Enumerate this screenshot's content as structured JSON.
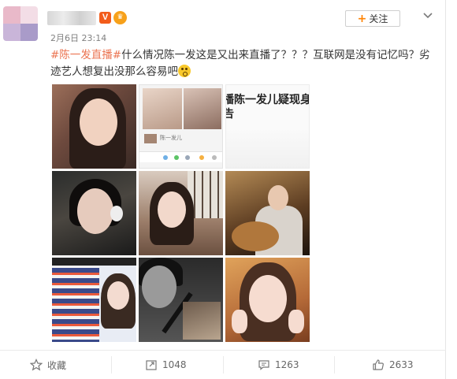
{
  "post": {
    "time": "2月6日 23:14",
    "follow_label": "关注",
    "hashtag": "#陈一发直播#",
    "text": "什么情况陈一发这是又出来直播了？？？互联网是没有记忆吗？劣迹艺人想复出没那么容易吧"
  },
  "images": {
    "thumb2_caption": "陈一发儿",
    "thumb3_headline_1": "播陈一发儿疑现身直播",
    "thumb3_headline_2": "告"
  },
  "actions": {
    "favorite_label": "收藏",
    "repost_count": "1048",
    "comment_count": "1263",
    "like_count": "2633"
  },
  "colors": {
    "hashtag": "#eb7350",
    "follow_plus": "#ff8200",
    "verified_badge": "#f25c1b"
  },
  "icons": {
    "verified": "v-badge-icon",
    "member": "crown-icon",
    "more": "chevron-down-icon",
    "favorite": "star-icon",
    "repost": "repost-icon",
    "comment": "comment-icon",
    "like": "thumbs-up-icon",
    "emoji": "shocked-emoji-icon"
  }
}
